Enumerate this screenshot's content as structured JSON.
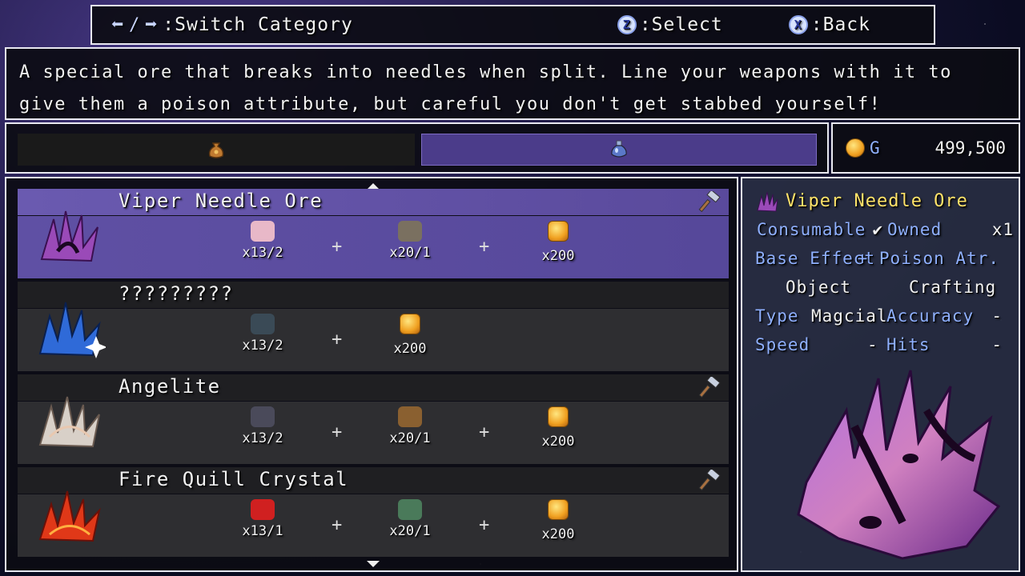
{
  "help": {
    "switch_label": ":Switch Category",
    "select_key": "Z",
    "select_label": ":Select",
    "back_key": "X",
    "back_label": ":Back"
  },
  "description": "A special ore that breaks into needles when split. Line your weapons with it to give them a poison attribute, but careful you don't get stabbed yourself!",
  "tabs": [
    {
      "icon": "bag-icon",
      "active": false
    },
    {
      "icon": "potion-icon",
      "active": true
    }
  ],
  "gold": {
    "unit": "G",
    "amount": "499,500"
  },
  "recipes": [
    {
      "name": "Viper Needle Ore",
      "selected": true,
      "craftable": true,
      "ingredients": [
        {
          "icon": "pink-material-icon",
          "qty": "x13/2"
        },
        {
          "icon": "bound-scroll-icon",
          "qty": "x20/1"
        },
        {
          "icon": "coin-icon",
          "qty": "x200"
        }
      ]
    },
    {
      "name": "?????????",
      "selected": false,
      "craftable": false,
      "ingredients": [
        {
          "icon": "dark-material-icon",
          "qty": "x13/2"
        },
        {
          "icon": "coin-icon",
          "qty": "x200"
        }
      ]
    },
    {
      "name": "Angelite",
      "selected": false,
      "craftable": true,
      "ingredients": [
        {
          "icon": "beast-claw-icon",
          "qty": "x13/2"
        },
        {
          "icon": "bundle-icon",
          "qty": "x20/1"
        },
        {
          "icon": "coin-icon",
          "qty": "x200"
        }
      ]
    },
    {
      "name": "Fire Quill Crystal",
      "selected": false,
      "craftable": true,
      "ingredients": [
        {
          "icon": "red-crystal-icon",
          "qty": "x13/1"
        },
        {
          "icon": "vial-icon",
          "qty": "x20/1"
        },
        {
          "icon": "coin-icon",
          "qty": "x200"
        }
      ]
    }
  ],
  "detail": {
    "name": "Viper Needle Ore",
    "consumable_label": "Consumable",
    "owned_label": "Owned",
    "owned_value": "x1",
    "base_effect_label": "Base Effect",
    "base_effect_value": "+ Poison Atr.",
    "object_label": "Object",
    "crafting_label": "Crafting",
    "type_label": "Type",
    "type_value": "Magcial",
    "accuracy_label": "Accuracy",
    "accuracy_value": "-",
    "speed_label": "Speed",
    "speed_value": "-",
    "hits_label": "Hits",
    "hits_value": "-"
  }
}
